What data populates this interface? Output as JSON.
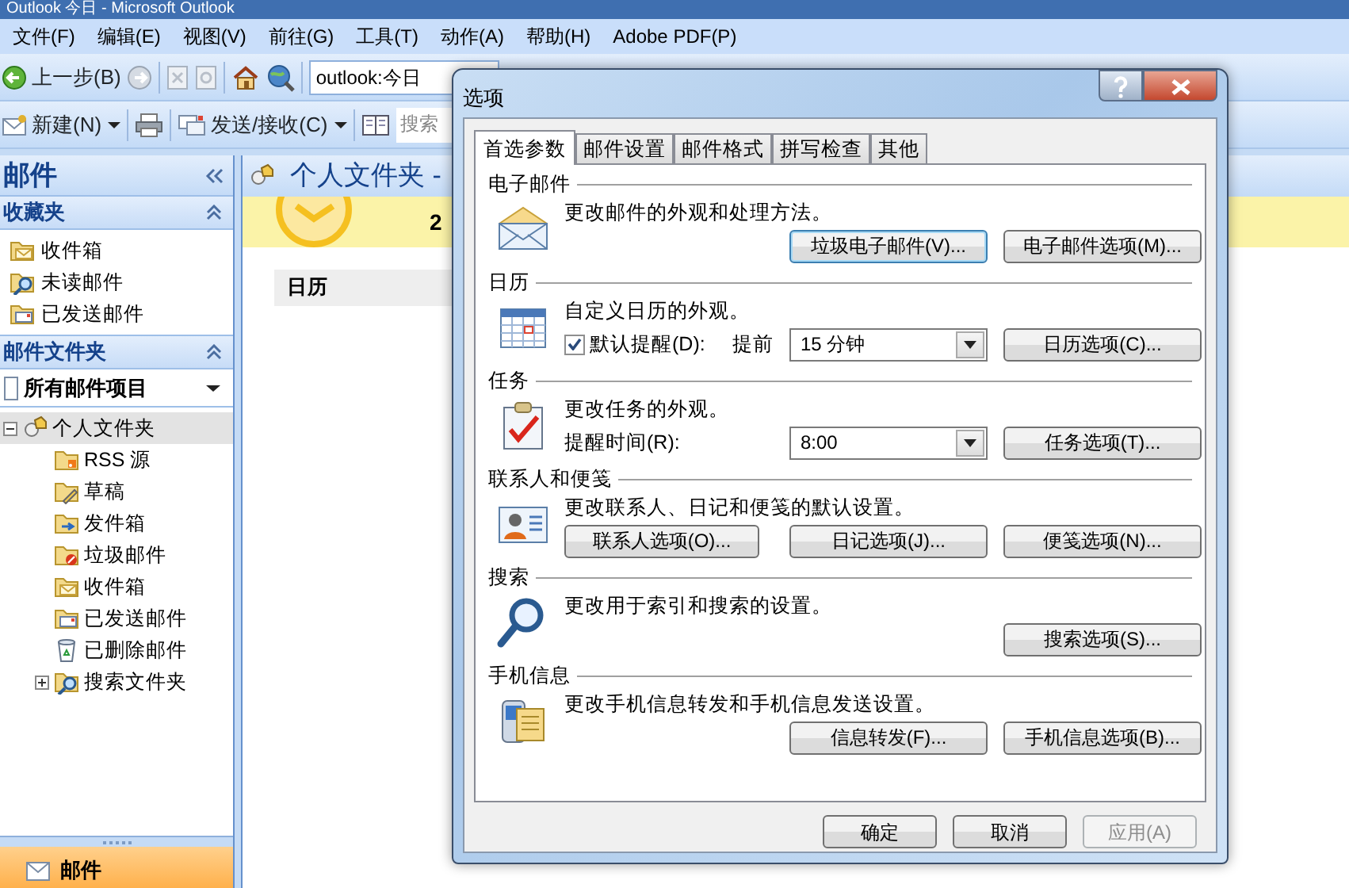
{
  "window": {
    "title": "Outlook 今日 - Microsoft Outlook"
  },
  "menu": [
    "文件(F)",
    "编辑(E)",
    "视图(V)",
    "前往(G)",
    "工具(T)",
    "动作(A)",
    "帮助(H)",
    "Adobe PDF(P)"
  ],
  "toolbar_1": {
    "back": "上一步(B)",
    "address": "outlook:今日"
  },
  "toolbar_2": {
    "new": "新建(N)",
    "send_receive": "发送/接收(C)",
    "search_placeholder": "搜索"
  },
  "nav_pane": {
    "title": "邮件",
    "favorites": {
      "title": "收藏夹",
      "expanded": true,
      "items": [
        {
          "label": "收件箱"
        },
        {
          "label": "未读邮件"
        },
        {
          "label": "已发送邮件"
        }
      ]
    },
    "folders": {
      "title": "邮件文件夹",
      "expanded": true,
      "view": "所有邮件项目",
      "tree": [
        {
          "label": "个人文件夹",
          "selected": true,
          "expanded": true,
          "children": [
            {
              "label": "RSS 源",
              "selected": false
            },
            {
              "label": "草稿",
              "selected": false
            },
            {
              "label": "发件箱",
              "selected": false
            },
            {
              "label": "垃圾邮件",
              "selected": false
            },
            {
              "label": "收件箱",
              "selected": false
            },
            {
              "label": "已发送邮件",
              "selected": false
            },
            {
              "label": "已删除邮件",
              "selected": false
            },
            {
              "label": "搜索文件夹",
              "selected": false,
              "expanded": false
            }
          ]
        }
      ]
    },
    "button": "邮件"
  },
  "main": {
    "folder_title": "个人文件夹 -",
    "banner_text": "2",
    "calendar_heading": "日历"
  },
  "dialog": {
    "title": "选项",
    "tabs": [
      {
        "label": "首选参数",
        "selected": true
      },
      {
        "label": "邮件设置",
        "selected": false
      },
      {
        "label": "邮件格式",
        "selected": false
      },
      {
        "label": "拼写检查",
        "selected": false
      },
      {
        "label": "其他",
        "selected": false
      }
    ],
    "sections": [
      {
        "heading": "电子邮件",
        "description": "更改邮件的外观和处理方法。",
        "row": {
          "middle": {
            "kind": "button",
            "label": "垃圾电子邮件(V)...",
            "focused": true
          },
          "right": {
            "kind": "button",
            "label": "电子邮件选项(M)...",
            "focused": false
          }
        }
      },
      {
        "heading": "日历",
        "description": "自定义日历的外观。",
        "row": {
          "left": [
            {
              "kind": "checkbox",
              "label": "默认提醒(D):",
              "checked": true
            },
            {
              "kind": "label",
              "text": "提前"
            }
          ],
          "middle": {
            "kind": "select",
            "value": "15 分钟"
          },
          "right": {
            "kind": "button",
            "label": "日历选项(C)...",
            "focused": false
          }
        }
      },
      {
        "heading": "任务",
        "description": "更改任务的外观。",
        "row": {
          "left": [
            {
              "kind": "label",
              "text": "提醒时间(R):"
            }
          ],
          "middle": {
            "kind": "select",
            "value": "8:00"
          },
          "right": {
            "kind": "button",
            "label": "任务选项(T)...",
            "focused": false
          }
        }
      },
      {
        "heading": "联系人和便笺",
        "description": "更改联系人、日记和便笺的默认设置。",
        "row": {
          "left": [
            {
              "kind": "button",
              "label": "联系人选项(O)...",
              "focused": false
            }
          ],
          "middle": {
            "kind": "button",
            "label": "日记选项(J)...",
            "focused": false
          },
          "right": {
            "kind": "button",
            "label": "便笺选项(N)...",
            "focused": false
          }
        }
      },
      {
        "heading": "搜索",
        "description": "更改用于索引和搜索的设置。",
        "row": {
          "right": {
            "kind": "button",
            "label": "搜索选项(S)...",
            "focused": false
          }
        }
      },
      {
        "heading": "手机信息",
        "description": "更改手机信息转发和手机信息发送设置。",
        "row": {
          "middle": {
            "kind": "button",
            "label": "信息转发(F)...",
            "focused": false
          },
          "right": {
            "kind": "button",
            "label": "手机信息选项(B)...",
            "focused": false
          }
        }
      }
    ],
    "buttons": [
      {
        "label": "确定",
        "disabled": false
      },
      {
        "label": "取消",
        "disabled": false
      },
      {
        "label": "应用(A)",
        "disabled": true
      }
    ]
  }
}
